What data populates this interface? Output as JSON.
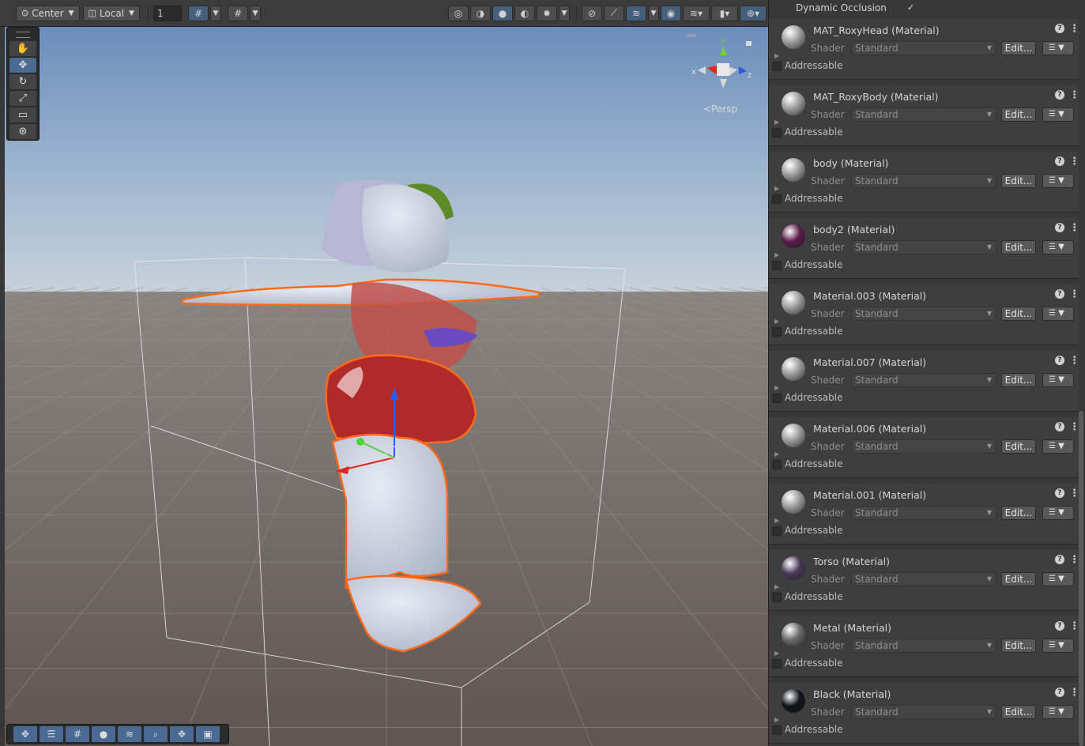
{
  "toolbar": {
    "pivot_label": "Center",
    "pivot_icon": "pivot-icon",
    "space_label": "Local",
    "space_icon": "cube-icon",
    "grid_snap_value": "1"
  },
  "scene_view": {
    "tools": [
      "hand-icon",
      "move-icon",
      "rotate-icon",
      "scale-icon",
      "rect-icon",
      "transform-icon"
    ],
    "selected_tool": "move-icon",
    "camera_mode_label": "Persp",
    "gizmo_axes": {
      "y": "y",
      "x": "x",
      "z": "z"
    },
    "bottom_overlay_tools": [
      "move-icon",
      "sliders-icon",
      "grid-icon",
      "circle-icon",
      "layers-icon",
      "search-icon",
      "pivot-icon",
      "camera-icon"
    ],
    "colors": {
      "selection_outline": "#ff6a1a",
      "sky_top": "#6d8fb8",
      "ground": "#6b615c"
    }
  },
  "inspector": {
    "dynamic_occlusion_label": "Dynamic Occlusion",
    "dynamic_occlusion_checked": true,
    "shader_label": "Shader",
    "edit_label": "Edit...",
    "addressable_label": "Addressable",
    "materials": [
      {
        "name": "MAT_RoxyHead (Material)",
        "shader": "Standard",
        "sphere_color": "#9a9a9a"
      },
      {
        "name": "MAT_RoxyBody (Material)",
        "shader": "Standard",
        "sphere_color": "#9a9a9a"
      },
      {
        "name": "body (Material)",
        "shader": "Standard",
        "sphere_color": "#9a9a9a"
      },
      {
        "name": "body2 (Material)",
        "shader": "Standard",
        "sphere_color": "#5a1a4a"
      },
      {
        "name": "Material.003 (Material)",
        "shader": "Standard",
        "sphere_color": "#9a9a9a"
      },
      {
        "name": "Material.007 (Material)",
        "shader": "Standard",
        "sphere_color": "#9a9a9a"
      },
      {
        "name": "Material.006 (Material)",
        "shader": "Standard",
        "sphere_color": "#9a9a9a"
      },
      {
        "name": "Material.001 (Material)",
        "shader": "Standard",
        "sphere_color": "#9a9a9a"
      },
      {
        "name": "Torso (Material)",
        "shader": "Standard",
        "sphere_color": "#4a3a5a"
      },
      {
        "name": "Metal (Material)",
        "shader": "Standard",
        "sphere_color": "#6a6a6a"
      },
      {
        "name": "Black (Material)",
        "shader": "Standard",
        "sphere_color": "#0e1218"
      }
    ]
  }
}
